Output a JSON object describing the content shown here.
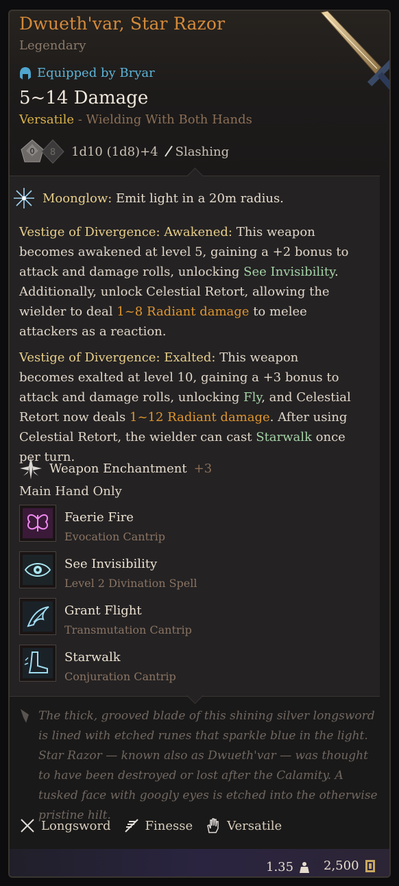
{
  "item": {
    "name": "Dwueth'var, Star Razor",
    "rarity": "Legendary",
    "equipped_by": "Equipped by Bryar",
    "damage": "5~14 Damage",
    "versatile_label": "Versatile",
    "versatile_detail": " - Wielding With Both Hands",
    "dice_left": "0",
    "dice_right": "8",
    "damage_roll": "1d10 (1d8)+4",
    "damage_type": "Slashing"
  },
  "moonglow": {
    "name": "Moonglow:",
    "desc": " Emit light in a 20m radius."
  },
  "awakened": {
    "title": "Vestige of Divergence: Awakened:",
    "t1": " This weapon becomes awakened at level 5, gaining a +2 bonus to attack and damage rolls, unlocking ",
    "link": "See Invisibility",
    "t2": ". Additionally, unlock Celestial Retort, allowing the wielder to deal ",
    "dmg": "1~8 Radiant damage",
    "t3": " to melee attackers as a reaction."
  },
  "exalted": {
    "title": "Vestige of Divergence: Exalted:",
    "t1": " This weapon becomes exalted at level 10, gaining a +3 bonus to attack and damage rolls, unlocking ",
    "link1": "Fly",
    "t2": ", and Celestial Retort now deals ",
    "dmg": "1~12 Radiant damage",
    "t3": ". After using Celestial Retort, the wielder can cast ",
    "link2": "Starwalk",
    "t4": " once per turn."
  },
  "enchantment": {
    "label": "Weapon Enchantment",
    "bonus": "+3"
  },
  "main_hand_only": "Main Hand Only",
  "spells": [
    {
      "name": "Faerie Fire",
      "sub": "Evocation Cantrip",
      "icon": "butterfly-icon"
    },
    {
      "name": "See Invisibility",
      "sub": "Level 2 Divination Spell",
      "icon": "eye-icon"
    },
    {
      "name": "Grant Flight",
      "sub": "Transmutation Cantrip",
      "icon": "wing-icon"
    },
    {
      "name": "Starwalk",
      "sub": "Conjuration Cantrip",
      "icon": "boot-icon"
    }
  ],
  "lore": "The thick, grooved blade of this shining silver longsword is lined with etched runes that sparkle blue in the light. Star Razor — known also as Dwueth'var — was thought to have been destroyed or lost after the Calamity. A tusked face with googly eyes is etched into the otherwise pristine hilt.",
  "properties": [
    {
      "label": "Longsword",
      "icon": "crossed-swords-icon"
    },
    {
      "label": "Finesse",
      "icon": "finesse-icon"
    },
    {
      "label": "Versatile",
      "icon": "hand-icon"
    }
  ],
  "weight": "1.35",
  "price": "2,500",
  "colors": {
    "title": "#d48a3a",
    "equipped": "#5db4d8",
    "highlight": "#e0962e",
    "link": "#a5d4a8",
    "keyword": "#e8cf8a"
  }
}
